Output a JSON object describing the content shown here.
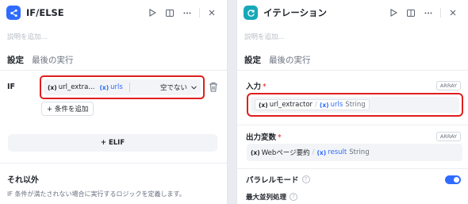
{
  "left_panel": {
    "title": "IF/ELSE",
    "description_placeholder": "説明を追加...",
    "tabs": [
      "設定",
      "最後の実行"
    ],
    "if_label": "IF",
    "condition": {
      "variable": "url_extra...",
      "field": "urls",
      "operator": "空でない"
    },
    "add_condition_label": "+ 条件を追加",
    "elif_label": "+ ELIF",
    "else_title": "それ以外",
    "else_description": "IF 条件が満たされない場合に実行するロジックを定義します。"
  },
  "right_panel": {
    "title": "イテレーション",
    "description_placeholder": "説明を追加...",
    "tabs": [
      "設定",
      "最後の実行"
    ],
    "input": {
      "label": "入力",
      "required_mark": "*",
      "type_badge": "ARRAY",
      "source": "url_extractor",
      "variable": "urls",
      "var_type": "String"
    },
    "output": {
      "label": "出力変数",
      "required_mark": "*",
      "type_badge": "ARRAY",
      "source": "Webページ要約",
      "variable": "result",
      "var_type": "String"
    },
    "parallel_mode_label": "パラレルモード",
    "parallel_mode_enabled": true,
    "max_parallel_label": "最大並列処理"
  },
  "icons": {
    "var_marker": "(x)",
    "help": "?"
  },
  "colors": {
    "accent": "#2f6bff",
    "highlight": "#e01e1e",
    "iteration_icon": "#17a8b8"
  }
}
